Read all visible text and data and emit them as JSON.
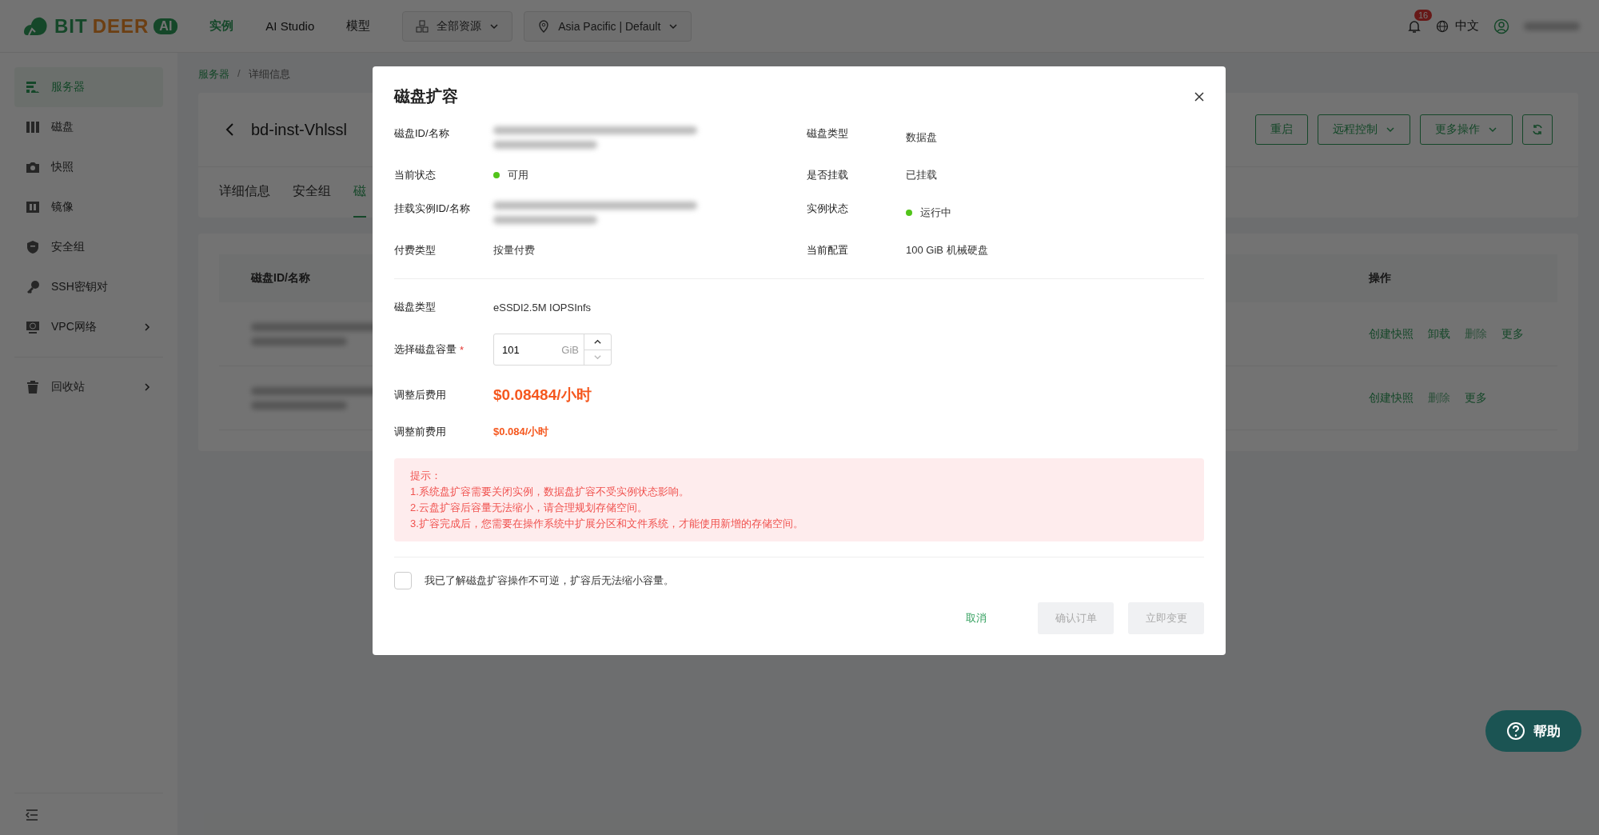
{
  "top_bar": {
    "logo": {
      "text_a": "BIT",
      "text_b": "DEER",
      "badge": "AI"
    },
    "nav": [
      {
        "label": "实例",
        "selected": true
      },
      {
        "label": "AI Studio",
        "selected": false
      },
      {
        "label": "模型",
        "selected": false
      }
    ],
    "dropdowns": [
      {
        "kind": "resource",
        "label": "全部资源"
      },
      {
        "kind": "region",
        "label": "Asia Pacific | Default"
      }
    ],
    "notification_count": "16",
    "language": "中文"
  },
  "sidebar": {
    "items": [
      {
        "label": "服务器",
        "kind": "server",
        "selected": true,
        "expandable": false
      },
      {
        "label": "磁盘",
        "kind": "disk",
        "selected": false,
        "expandable": false
      },
      {
        "label": "快照",
        "kind": "camera",
        "selected": false,
        "expandable": false
      },
      {
        "label": "镜像",
        "kind": "image",
        "selected": false,
        "expandable": false
      },
      {
        "label": "安全组",
        "kind": "shield",
        "selected": false,
        "expandable": false
      },
      {
        "label": "SSH密钥对",
        "kind": "key",
        "selected": false,
        "expandable": false
      },
      {
        "label": "VPC网络",
        "kind": "network",
        "selected": false,
        "expandable": true
      }
    ],
    "bottom_items": [
      {
        "label": "回收站",
        "kind": "trash",
        "selected": false,
        "expandable": true
      }
    ]
  },
  "breadcrumb": {
    "items": [
      "服务器",
      "详细信息"
    ],
    "separator": "/"
  },
  "header": {
    "title": "bd-inst-Vhlssl",
    "buttons": [
      {
        "label": "重启",
        "kind": "plain"
      },
      {
        "label": "远程控制",
        "kind": "menu"
      },
      {
        "label": "更多操作",
        "kind": "menu"
      },
      {
        "kind": "refresh"
      }
    ]
  },
  "tabs": [
    {
      "label": "详细信息",
      "selected": false
    },
    {
      "label": "安全组",
      "selected": false
    },
    {
      "label": "磁",
      "selected": true
    }
  ],
  "table": {
    "columns": [
      "磁盘ID/名称",
      "操作"
    ],
    "rows": [
      {
        "actions": [
          {
            "label": "创建快照",
            "disabled": false
          },
          {
            "label": "卸载",
            "disabled": false
          },
          {
            "label": "删除",
            "disabled": true
          },
          {
            "label": "更多",
            "disabled": false
          }
        ]
      },
      {
        "actions": [
          {
            "label": "创建快照",
            "disabled": false
          },
          {
            "label": "删除",
            "disabled": true
          },
          {
            "label": "更多",
            "disabled": false
          }
        ]
      }
    ]
  },
  "dialog": {
    "title": "磁盘扩容",
    "info": [
      {
        "label": "磁盘ID/名称",
        "kind": "redacted"
      },
      {
        "label": "磁盘类型",
        "kind": "text",
        "value": "数据盘"
      },
      {
        "label": "当前状态",
        "kind": "status",
        "value": "可用",
        "color": "#52c41a"
      },
      {
        "label": "是否挂载",
        "kind": "text",
        "value": "已挂载"
      },
      {
        "label": "挂载实例ID/名称",
        "kind": "redacted"
      },
      {
        "label": "实例状态",
        "kind": "status",
        "value": "运行中",
        "color": "#52c41a"
      },
      {
        "label": "付费类型",
        "kind": "text",
        "value": "按量付费"
      },
      {
        "label": "当前配置",
        "kind": "text",
        "value": "100 GiB 机械硬盘"
      }
    ],
    "disk_type": {
      "label": "磁盘类型",
      "value": "eSSDI2.5M IOPSInfs"
    },
    "capacity": {
      "label": "选择磁盘容量",
      "required_mark": "*",
      "value": "101",
      "unit": "GiB"
    },
    "new_cost": {
      "label": "调整后费用",
      "value": "$0.08484/小时"
    },
    "old_cost": {
      "label": "调整前费用",
      "value": "$0.084/小时"
    },
    "notice": [
      "提示：",
      "1.系统盘扩容需要关闭实例，数据盘扩容不受实例状态影响。",
      "2.云盘扩容后容量无法缩小，请合理规划存储空间。",
      "3.扩容完成后，您需要在操作系统中扩展分区和文件系统，才能使用新增的存储空间。"
    ],
    "acknowledge": {
      "label": "我已了解磁盘扩容操作不可逆，扩容后无法缩小容量。",
      "checked": false
    },
    "buttons": [
      {
        "label": "取消",
        "kind": "text",
        "disabled": false
      },
      {
        "label": "确认订单",
        "kind": "fill",
        "disabled": true
      },
      {
        "label": "立即变更",
        "kind": "fill",
        "disabled": true
      }
    ]
  },
  "help_button": {
    "label": "帮助"
  }
}
